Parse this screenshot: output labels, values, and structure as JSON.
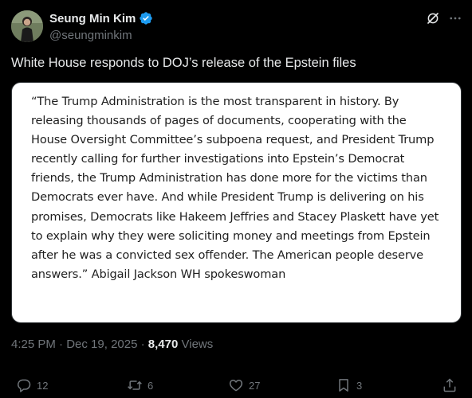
{
  "author": {
    "display_name": "Seung Min Kim",
    "handle": "@seungminkim",
    "verified": true,
    "verified_color": "#1d9bf0"
  },
  "tweet": {
    "text": "White House responds to DOJ’s release of the Epstein files",
    "quote_image_lines": [
      "“The Trump Administration is the most transparent in history. By",
      "releasing thousands of pages of documents, cooperating with the",
      "House Oversight Committee’s subpoena request, and President Trump",
      "recently calling for further investigations into Epstein’s Democrat",
      "friends, the Trump Administration has done more for the victims than",
      "Democrats ever have. And while President Trump is delivering on his",
      "promises, Democrats like Hakeem Jeffries and Stacey Plaskett have yet",
      "to explain why they were soliciting money and meetings from Epstein",
      "after he was a convicted sex offender. The American people deserve",
      "answers.” Abigail Jackson WH spokeswoman"
    ]
  },
  "meta": {
    "time": "4:25 PM",
    "separator": "·",
    "date": "Dec 19, 2025",
    "views_count": "8,470",
    "views_label": "Views"
  },
  "actions": {
    "replies": "12",
    "reposts": "6",
    "likes": "27",
    "bookmarks": "3"
  },
  "icons": [
    "grok-icon",
    "more-icon",
    "verified-icon",
    "reply-icon",
    "repost-icon",
    "like-icon",
    "bookmark-icon",
    "share-icon"
  ]
}
